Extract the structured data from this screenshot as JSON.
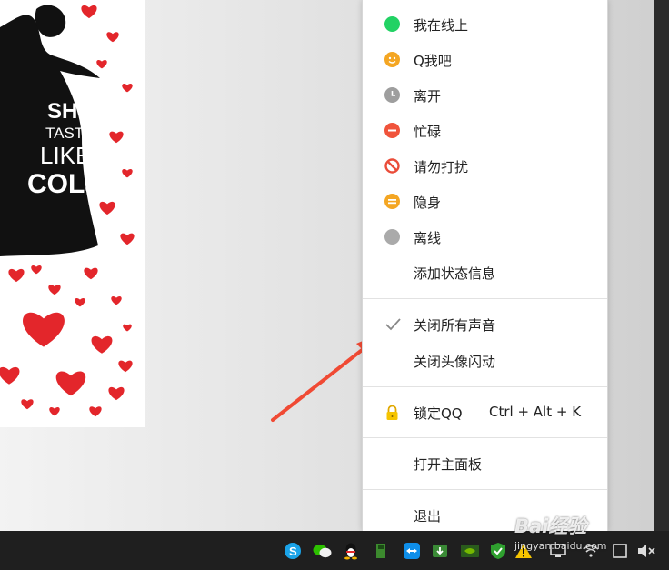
{
  "wallpaper": {
    "poster_lines": [
      "SHE",
      "TASTES",
      "LIKE",
      "COLa"
    ],
    "colors": {
      "background": "#ffffff",
      "hearts": "#e3262b",
      "silhouette": "#111111"
    }
  },
  "menu": {
    "status_items": [
      {
        "label": "我在线上",
        "icon": "online-status-icon",
        "color": "#22d264"
      },
      {
        "label": "Q我吧",
        "icon": "q-me-status-icon",
        "color": "#f4a623"
      },
      {
        "label": "离开",
        "icon": "away-clock-icon",
        "color": "#9e9e9e"
      },
      {
        "label": "忙碌",
        "icon": "busy-icon",
        "color": "#f0533b"
      },
      {
        "label": "请勿打扰",
        "icon": "do-not-disturb-icon",
        "color": "#ea4d3a"
      },
      {
        "label": "隐身",
        "icon": "invisible-icon",
        "color": "#f4a623"
      },
      {
        "label": "离线",
        "icon": "offline-icon",
        "color": "#aaaaaa"
      }
    ],
    "add_status_label": "添加状态信息",
    "mute_all_label": "关闭所有声音",
    "mute_all_checked": true,
    "close_avatar_flash_label": "关闭头像闪动",
    "lock_label": "锁定QQ",
    "lock_shortcut": "Ctrl + Alt + K",
    "open_panel_label": "打开主面板",
    "exit_label": "退出"
  },
  "annotation": {
    "arrow_color": "#f04a34"
  },
  "taskbar": {
    "tray_icons": [
      "skype-icon",
      "wechat-icon",
      "qq-penguin-icon",
      "usb-drive-icon",
      "teamviewer-icon",
      "update-icon",
      "nvidia-icon",
      "shield-icon",
      "warning-icon",
      "display-icon",
      "wifi-icon",
      "tablet-icon",
      "volume-mute-icon"
    ]
  },
  "watermark": {
    "brand": "Bai经验",
    "url": "jingyan.baidu.com"
  }
}
